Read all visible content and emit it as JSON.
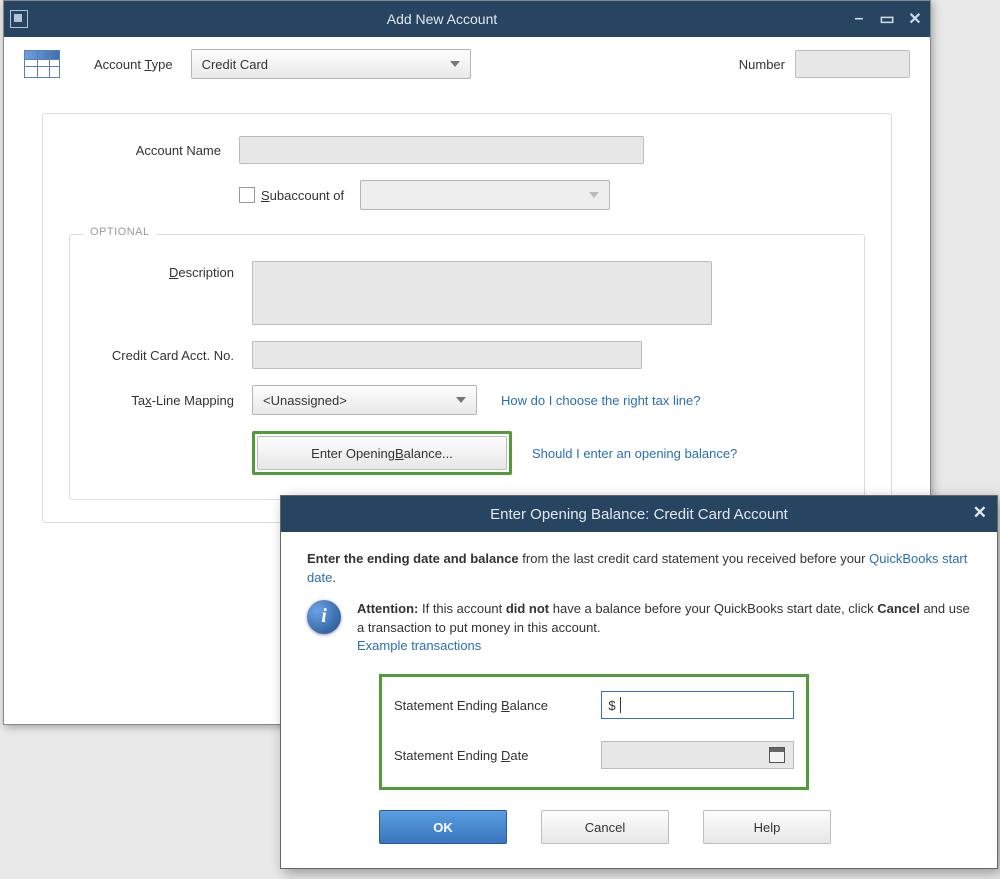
{
  "mainWindow": {
    "title": "Add New Account",
    "accountTypeLabel": "Account Type",
    "accountTypeValue": "Credit Card",
    "numberLabel": "Number",
    "accountNameLabel": "Account Name",
    "subaccountLabel": "Subaccount of",
    "optionalLegend": "OPTIONAL",
    "descriptionLabel": "Description",
    "ccAcctNoLabel": "Credit Card Acct. No.",
    "taxLineLabel": "Tax-Line Mapping",
    "taxLineValue": "<Unassigned>",
    "taxHelpLink": "How do I choose the right tax line?",
    "openingBalanceBtn": "Enter Opening Balance...",
    "openingBalanceHelp": "Should I enter an opening balance?"
  },
  "modal": {
    "title": "Enter Opening Balance: Credit Card Account",
    "instrBold": "Enter the ending date and balance",
    "instrRest1": " from the last credit card statement you received before your ",
    "instrLink": "QuickBooks start date",
    "instrRest2": ".",
    "attnLabel": "Attention:",
    "attnText1": " If this account ",
    "attnBold1": "did not",
    "attnText2": " have a balance before your QuickBooks start date, click ",
    "attnBold2": "Cancel",
    "attnText3": " and use a transaction to put money in this account.",
    "exampleLink": "Example transactions",
    "stmtBalanceLabel": "Statement Ending Balance",
    "stmtBalanceValue": "$",
    "stmtDateLabel": "Statement Ending Date",
    "okBtn": "OK",
    "cancelBtn": "Cancel",
    "helpBtn": "Help"
  },
  "underlineChars": {
    "T": "T",
    "S_sub": "S",
    "D_desc": "D",
    "x_tax": "x",
    "B_balance": "B",
    "B_stmtBal": "B",
    "D_stmtDate": "D"
  },
  "text": {
    "account": "Account ",
    "ype": "ype",
    "ubaccount_of": "ubaccount of",
    "escription": "escription",
    "Ta": "Ta",
    "LineMapping": "-Line Mapping",
    "EnterOpening": "Enter Opening ",
    "alance": "alance...",
    "stmtEndingPre": "Statement Ending ",
    "alance2": "alance",
    "ate": "ate"
  }
}
